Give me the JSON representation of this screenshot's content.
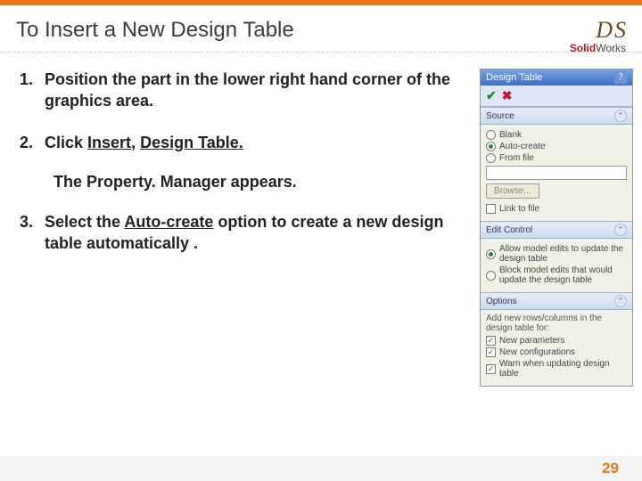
{
  "slide": {
    "title": "To Insert a New Design Table",
    "page_number": "29"
  },
  "logo": {
    "brand_bold": "Solid",
    "brand_rest": "Works"
  },
  "steps": {
    "s1": "Position the part in the lower right hand corner of the graphics area.",
    "s2_a": "Click ",
    "s2_b": "Insert,",
    "s2_c": " ",
    "s2_d": "Design Table.",
    "sub": "The Property. Manager appears.",
    "s3_a": "Select the ",
    "s3_b": "Auto-create",
    "s3_c": " option to create a new design table automatically ."
  },
  "panel": {
    "title": "Design Table",
    "sections": {
      "source": {
        "label": "Source",
        "options": {
          "blank": "Blank",
          "auto": "Auto-create",
          "file": "From file"
        },
        "browse": "Browse...",
        "link": "Link to file"
      },
      "edit": {
        "label": "Edit Control",
        "opt1": "Allow model edits to update the design table",
        "opt2": "Block model edits that would update the design table"
      },
      "options": {
        "label": "Options",
        "intro": "Add new rows/columns in the design table for:",
        "new_params": "New parameters",
        "new_configs": "New configurations",
        "warn": "Warn when updating design table"
      }
    }
  }
}
